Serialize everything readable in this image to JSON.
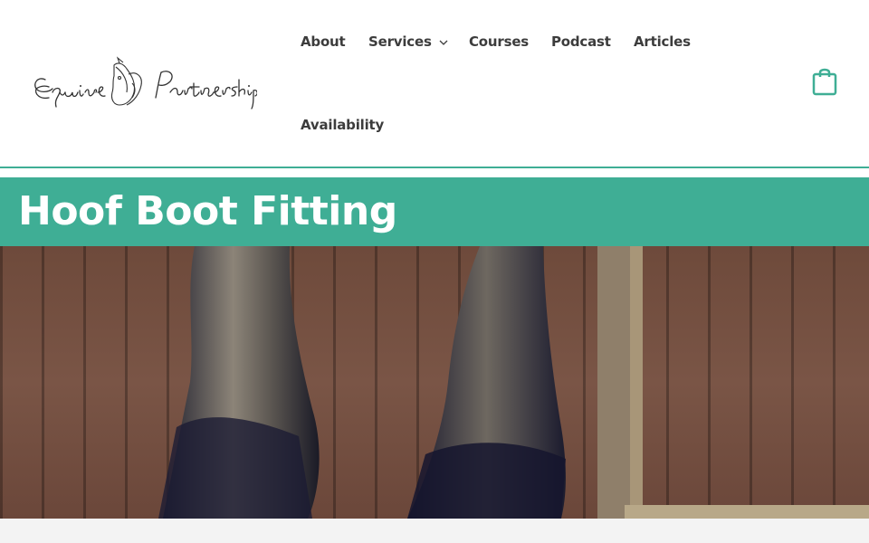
{
  "site": {
    "logo_text": "Equine Partnership"
  },
  "nav": {
    "items": [
      {
        "label": "About"
      },
      {
        "label": "Services"
      },
      {
        "label": "Courses"
      },
      {
        "label": "Podcast"
      },
      {
        "label": "Articles"
      },
      {
        "label": "Availability"
      }
    ],
    "services_icon": "chevron-down-icon"
  },
  "cart": {
    "icon": "shopping-bag-icon"
  },
  "page": {
    "title": "Hoof Boot Fitting"
  },
  "colors": {
    "accent": "#3fae95",
    "nav_text": "#3c3c3c",
    "title_text": "#ffffff"
  }
}
